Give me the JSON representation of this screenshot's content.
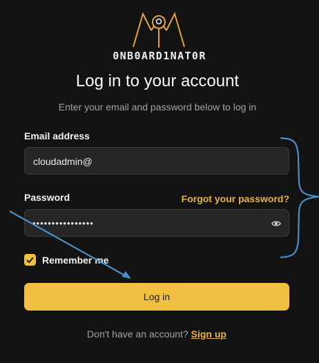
{
  "brand": {
    "name": "0NB0ARD1NAT0R",
    "accent_color": "#e7a33e"
  },
  "header": {
    "title": "Log in to your account",
    "subtitle": "Enter your email and password below to log in"
  },
  "form": {
    "email_label": "Email address",
    "email_value": "cloudadmin@",
    "password_label": "Password",
    "password_masked": "••••••••••••••••",
    "forgot_link": "Forgot your password?",
    "remember_label": "Remember me",
    "remember_checked": true,
    "submit_label": "Log in"
  },
  "footer": {
    "prompt": "Don't have an account?",
    "signup_link": "Sign up"
  },
  "icons": {
    "logo": "onboardinator-logo-icon",
    "password_toggle": "eye-icon",
    "checkbox": "checkmark-icon"
  },
  "annotation": {
    "color": "#4a90c8"
  }
}
